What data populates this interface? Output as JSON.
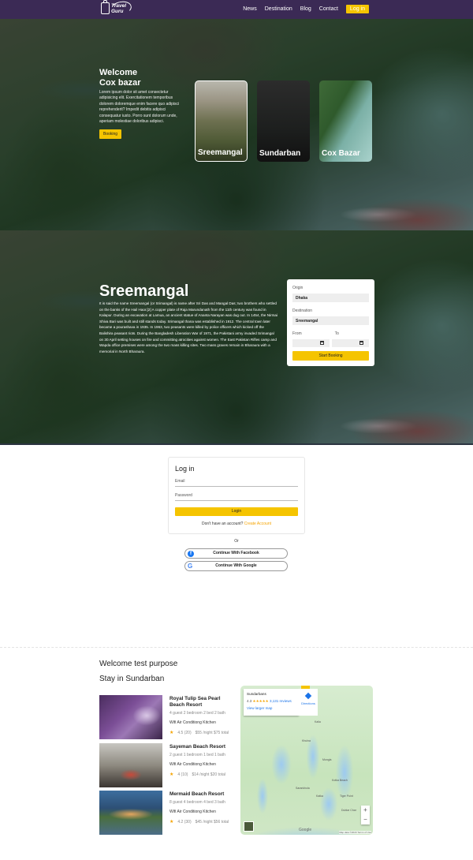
{
  "nav": {
    "logo_line1": "Travel",
    "logo_line2": "Guru",
    "links": [
      "News",
      "Destination",
      "Blog",
      "Contact"
    ],
    "login": "Log in"
  },
  "hero": {
    "title_line1": "Welcome",
    "title_line2": "Cox bazar",
    "description": "Lorem ipsum dolor sit amet consectetur adipisicing elit. Exercitationem temporibus dolorem doloremque enim facere quo adipisci reprehenderit? Impedit debitis adipisci consequatur iusto. Porro sunt dolorum unde, aperiam molestiae doloribus adipisci.",
    "booking_button": "Booking",
    "cards": [
      "Sreemangal",
      "Sundarban",
      "Cox Bazar"
    ]
  },
  "detail": {
    "title": "Sreemangal",
    "description": "It is said the name Sreemangal (or Srimangal) is name after Sri Das and Mangal Das; two brothers who settled on the banks of the Hail Haor.[2] A copper plate of Raja Marundanath from the 11th century was found in Kalapur. During an excavation at Lamua, an ancient statue of Ananta Narayan was dug out. In 1454, the Nirmai Shiva Bari was built and still stands today. Srimangal thana was established in 1912. The central town later became a pourashava in 1935. In 1963, two peasants were killed by police officers which kicked off the Balishira peasant riots. During the Bangladesh Liberation War of 1971, the Pakistani army invaded Srimangal on 30 April setting houses on fire and committing atrocities against women. The East Pakistan Rifles camp and Wapda office premises were among the two mass killing sites. Two mass graves remain in Bharaura with a memorial in North Bharaura."
  },
  "booking": {
    "origin_label": "Origin",
    "origin_value": "Dhaka",
    "destination_label": "Destination",
    "destination_value": "Sreemangal",
    "from_label": "From",
    "to_label": "To",
    "submit": "Start Booking"
  },
  "login": {
    "title": "Log in",
    "email_placeholder": "Email",
    "password_placeholder": "Password",
    "submit": "Login",
    "no_account": "Don't have an account?",
    "create_account": "Create Account",
    "or": "Or",
    "facebook": "Continue With Facebook",
    "google": "Continue With Google"
  },
  "stay": {
    "welcome": "Welcome test purpose",
    "title": "Stay in Sundarban",
    "hotels": [
      {
        "name": "Royal Tulip Sea Pearl Beach Resort",
        "spec": "4 guest  2 bedroom  2 bed  2 bath",
        "amenities": "Wifi Air Conditiong Kitchen",
        "rating": "4.5 (20)",
        "price": "$55 /night  $75 total"
      },
      {
        "name": "Sayeman Beach Resort",
        "spec": "2 guest  1 bedroom  1 bed  1 bath",
        "amenities": "Wifi Air Conditiong Kitchen",
        "rating": "4 (10)",
        "price": "$14 /night  $20 total"
      },
      {
        "name": "Mermaid Beach Resort",
        "spec": "8 guest  4 bedroom  4 bed  3 bath",
        "amenities": "Wifi Air Conditiong Kitchen",
        "rating": "4.2 (30)",
        "price": "$45 /night  $56 total"
      }
    ]
  },
  "map": {
    "place": "Sundarbans",
    "rating": "4.3",
    "stars": "★★★★★",
    "reviews": "3,131 reviews",
    "directions": "Directions",
    "view_larger": "View larger map",
    "google": "Google",
    "attribution": "Map data ©2020  Terms of Use",
    "labels": [
      "Kalia",
      "Khulna",
      "Mongla",
      "Sarankhola",
      "Dublar Char",
      "Katka",
      "Kotka Beach",
      "Tiger Point"
    ]
  },
  "colors": {
    "nav_bg": "#3b2a55",
    "accent": "#f5c400"
  }
}
